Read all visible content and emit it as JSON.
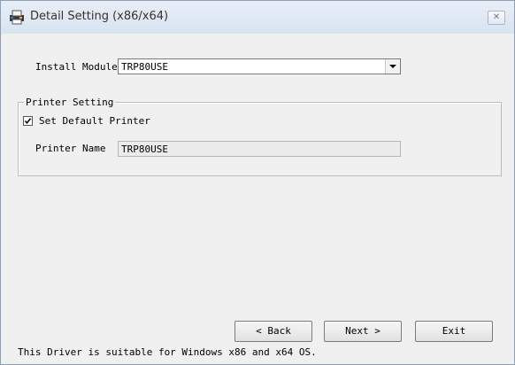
{
  "window": {
    "title": "Detail Setting (x86/x64)",
    "close_glyph": "✕",
    "icon": "printer-app-icon"
  },
  "install_module": {
    "label": "Install Module",
    "selected": "TRP80USE"
  },
  "printer_setting": {
    "group_label": "Printer Setting",
    "set_default": {
      "label": "Set Default Printer",
      "checked": true
    },
    "printer_name": {
      "label": "Printer Name",
      "value": "TRP80USE"
    }
  },
  "buttons": {
    "back": "< Back",
    "next": "Next >",
    "exit": "Exit"
  },
  "footer": {
    "note": "This Driver is suitable for Windows x86 and x64 OS."
  }
}
